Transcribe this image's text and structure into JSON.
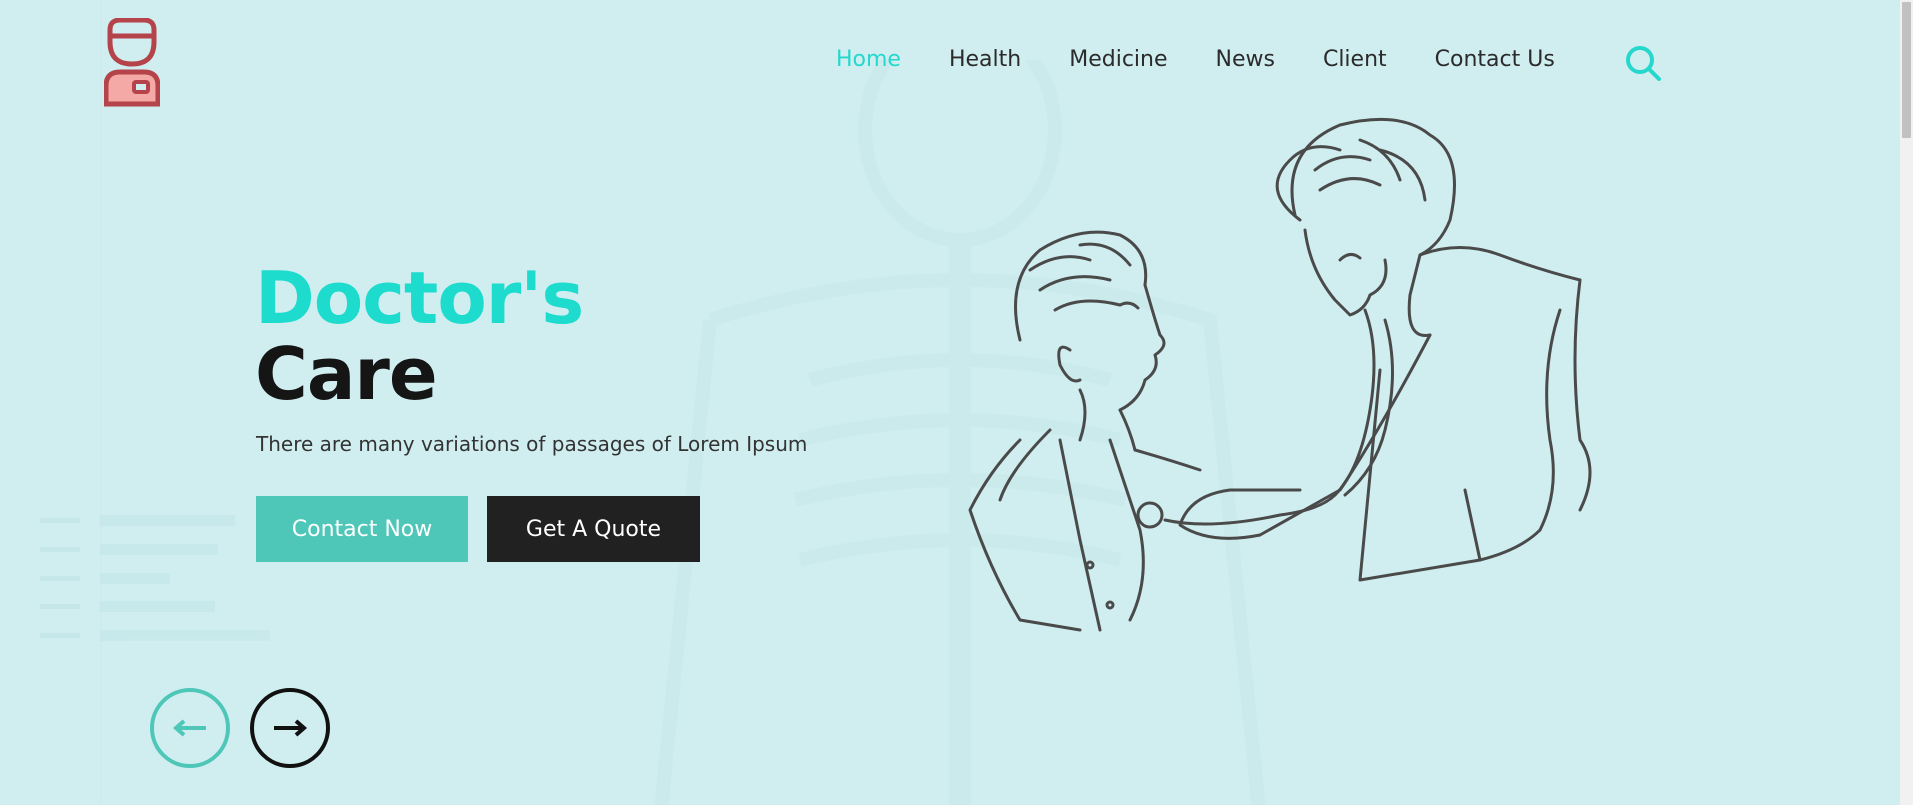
{
  "logo": {
    "icon": "doctor-logo-icon"
  },
  "nav": {
    "items": [
      {
        "label": "Home",
        "active": true
      },
      {
        "label": "Health",
        "active": false
      },
      {
        "label": "Medicine",
        "active": false
      },
      {
        "label": "News",
        "active": false
      },
      {
        "label": "Client",
        "active": false
      },
      {
        "label": "Contact Us",
        "active": false
      }
    ],
    "search_icon": "search-icon"
  },
  "hero": {
    "title_line1": "Doctor's",
    "title_line2": "Care",
    "subtitle": "There are many variations of passages of Lorem Ipsum",
    "primary_button": "Contact Now",
    "secondary_button": "Get A Quote"
  },
  "slider": {
    "prev_icon": "arrow-left-icon",
    "next_icon": "arrow-right-icon"
  },
  "colors": {
    "background": "#d0eef0",
    "accent": "#1ddbcd",
    "button_primary": "#4ec7b8",
    "button_secondary": "#212121",
    "logo_red": "#b5434a",
    "logo_pink": "#f4a9a6"
  }
}
